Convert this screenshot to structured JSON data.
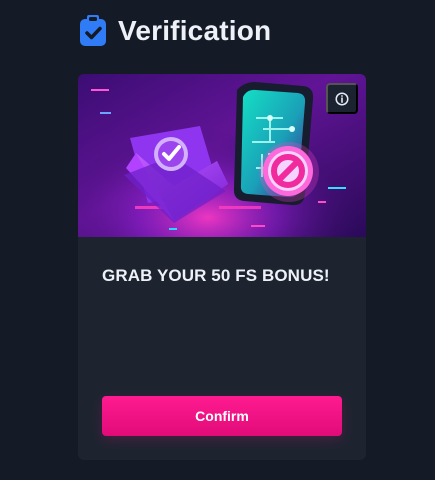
{
  "header": {
    "title": "Verification",
    "icon": "clipboard-check-icon"
  },
  "card": {
    "banner_icons": [
      "email-check-icon",
      "phone-block-icon",
      "info-icon"
    ],
    "headline": "GRAB YOUR 50 FS BONUS!",
    "confirm_label": "Confirm"
  },
  "colors": {
    "background": "#151b26",
    "card": "#1d2430",
    "accent": "#ff1b91",
    "icon_blue": "#2f7cf6"
  }
}
